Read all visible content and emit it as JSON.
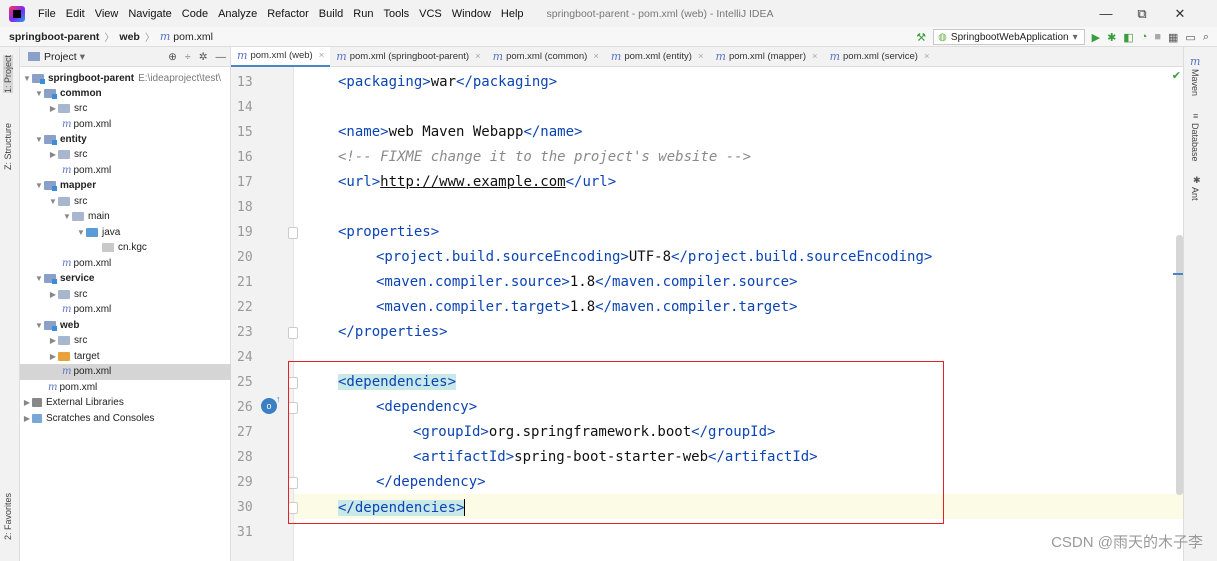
{
  "menu": {
    "items": [
      {
        "label": "File"
      },
      {
        "label": "Edit"
      },
      {
        "label": "View"
      },
      {
        "label": "Navigate"
      },
      {
        "label": "Code"
      },
      {
        "label": "Analyze"
      },
      {
        "label": "Refactor"
      },
      {
        "label": "Build"
      },
      {
        "label": "Run"
      },
      {
        "label": "Tools"
      },
      {
        "label": "VCS"
      },
      {
        "label": "Window"
      },
      {
        "label": "Help"
      }
    ],
    "window_title": "springboot-parent - pom.xml (web) - IntelliJ IDEA"
  },
  "window_controls": {
    "minimize": "—",
    "restore": "⧉",
    "close": "✕"
  },
  "breadcrumb": {
    "root": "springboot-parent",
    "module": "web",
    "file": "pom.xml"
  },
  "run_config": {
    "label": "SpringbootWebApplication"
  },
  "left_stripe": {
    "project": "1: Project",
    "structure": "Z: Structure",
    "favorites": "2: Favorites"
  },
  "right_stripe": {
    "maven": "Maven",
    "database": "Database",
    "ant": "Ant"
  },
  "project_panel": {
    "title": "Project",
    "tree": [
      {
        "label": "springboot-parent",
        "hint": "E:\\ideaproject\\test\\"
      },
      {
        "label": "common"
      },
      {
        "label": "src"
      },
      {
        "label": "pom.xml"
      },
      {
        "label": "entity"
      },
      {
        "label": "src"
      },
      {
        "label": "pom.xml"
      },
      {
        "label": "mapper"
      },
      {
        "label": "src"
      },
      {
        "label": "main"
      },
      {
        "label": "java"
      },
      {
        "label": "cn.kgc"
      },
      {
        "label": "pom.xml"
      },
      {
        "label": "service"
      },
      {
        "label": "src"
      },
      {
        "label": "pom.xml"
      },
      {
        "label": "web"
      },
      {
        "label": "src"
      },
      {
        "label": "target"
      },
      {
        "label": "pom.xml"
      },
      {
        "label": "pom.xml"
      },
      {
        "label": "External Libraries"
      },
      {
        "label": "Scratches and Consoles"
      }
    ]
  },
  "tabs": [
    {
      "label": "pom.xml (web)"
    },
    {
      "label": "pom.xml (springboot-parent)"
    },
    {
      "label": "pom.xml (common)"
    },
    {
      "label": "pom.xml (entity)"
    },
    {
      "label": "pom.xml (mapper)"
    },
    {
      "label": "pom.xml (service)"
    }
  ],
  "editor": {
    "line_numbers": [
      "13",
      "14",
      "15",
      "16",
      "17",
      "18",
      "19",
      "20",
      "21",
      "22",
      "23",
      "24",
      "25",
      "26",
      "27",
      "28",
      "29",
      "30",
      "31"
    ],
    "lines": {
      "l13": {
        "open": "<packaging>",
        "text": "war",
        "close": "</packaging>"
      },
      "l15": {
        "open": "<name>",
        "text": "web Maven Webapp",
        "close": "</name>"
      },
      "l16": {
        "comment": "<!-- FIXME change it to the project's website -->"
      },
      "l17": {
        "open": "<url>",
        "text": "http://www.example.com",
        "close": "</url>"
      },
      "l19": {
        "open": "<properties>"
      },
      "l20": {
        "open": "<project.build.sourceEncoding>",
        "text": "UTF-8",
        "close": "</project.build.sourceEncoding>"
      },
      "l21": {
        "open": "<maven.compiler.source>",
        "text": "1.8",
        "close": "</maven.compiler.source>"
      },
      "l22": {
        "open": "<maven.compiler.target>",
        "text": "1.8",
        "close": "</maven.compiler.target>"
      },
      "l23": {
        "close": "</properties>"
      },
      "l25": {
        "open": "<dependencies>"
      },
      "l26": {
        "open": "<dependency>"
      },
      "l27": {
        "open": "<groupId>",
        "text": "org.springframework.boot",
        "close": "</groupId>"
      },
      "l28": {
        "open": "<artifactId>",
        "text": "spring-boot-starter-web",
        "close": "</artifactId>"
      },
      "l29": {
        "close": "</dependency>"
      },
      "l30": {
        "close": "</dependencies>"
      }
    }
  },
  "watermark": "CSDN @雨天的木子李",
  "colors": {
    "tag": "#0b44b4",
    "comment": "#8a8a8a",
    "highlight_box": "#e02424",
    "matched_tag_bg": "#c9e8e8"
  }
}
